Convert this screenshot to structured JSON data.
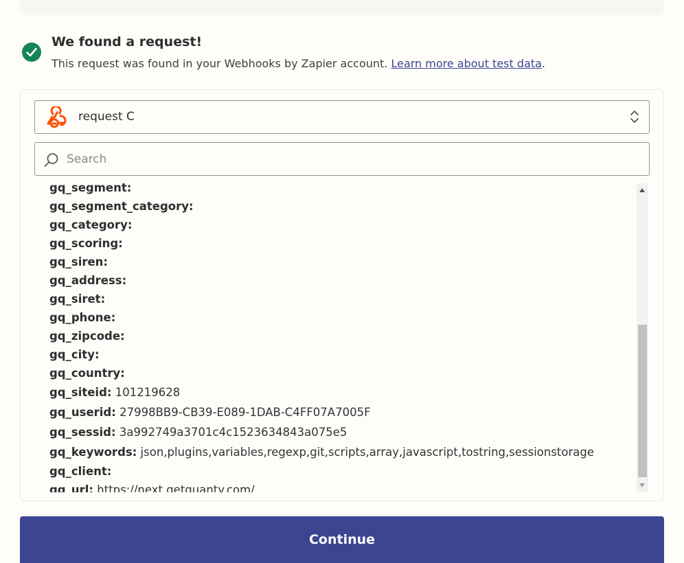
{
  "found": {
    "title": "We found a request!",
    "description": "This request was found in your Webhooks by Zapier account. ",
    "link_text": "Learn more about test data",
    "trailing": ".",
    "status_icon": "check-circle-icon",
    "status_color": "#138656"
  },
  "request_select": {
    "value": "request C",
    "icon": "webhook-icon",
    "icon_color": "#ff4f00"
  },
  "search": {
    "placeholder": "Search",
    "value": ""
  },
  "fields": [
    {
      "key": "gq_segment:",
      "value": ""
    },
    {
      "key": "gq_segment_category:",
      "value": ""
    },
    {
      "key": "gq_category:",
      "value": ""
    },
    {
      "key": "gq_scoring:",
      "value": ""
    },
    {
      "key": "gq_siren:",
      "value": ""
    },
    {
      "key": "gq_address:",
      "value": ""
    },
    {
      "key": "gq_siret:",
      "value": ""
    },
    {
      "key": "gq_phone:",
      "value": ""
    },
    {
      "key": "gq_zipcode:",
      "value": ""
    },
    {
      "key": "gq_city:",
      "value": ""
    },
    {
      "key": "gq_country:",
      "value": ""
    },
    {
      "key": "gq_siteid:",
      "value": "101219628"
    },
    {
      "key": "gq_userid:",
      "value": "27998BB9-CB39-E089-1DAB-C4FF07A7005F"
    },
    {
      "key": "gq_sessid:",
      "value": "3a992749a3701c4c1523634843a075e5"
    },
    {
      "key": "gq_keywords:",
      "value": "json,plugins,variables,regexp,git,scripts,array,javascript,tostring,sessionstorage"
    },
    {
      "key": "gq_client:",
      "value": ""
    },
    {
      "key": "gq_url:",
      "value": "https://next.getquanty.com/"
    }
  ],
  "continue_label": "Continue",
  "colors": {
    "accent": "#3d4592",
    "background": "#fffdf9"
  }
}
